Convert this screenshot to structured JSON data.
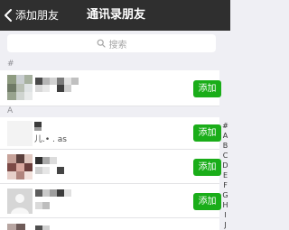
{
  "navbar": {
    "back_label": "添加朋友",
    "title": "通讯录朋友"
  },
  "search": {
    "placeholder": "搜索"
  },
  "sections": {
    "hash_letter": "#",
    "a_letter": "A"
  },
  "contacts": [
    {
      "add_label": "添加"
    },
    {
      "add_label": "添加",
      "sub_text": "儿.• . as"
    },
    {
      "add_label": "添加"
    },
    {
      "add_label": "添加"
    }
  ],
  "index_letters": [
    "#",
    "A",
    "B",
    "C",
    "D",
    "E",
    "F",
    "G",
    "H",
    "I",
    "J",
    "K"
  ],
  "colors": {
    "navbar_bg": "#2f2f2f",
    "accent_green": "#1aad19",
    "background": "#efeff4"
  },
  "icons": {
    "back": "chevron-left-icon",
    "search": "search-icon"
  }
}
